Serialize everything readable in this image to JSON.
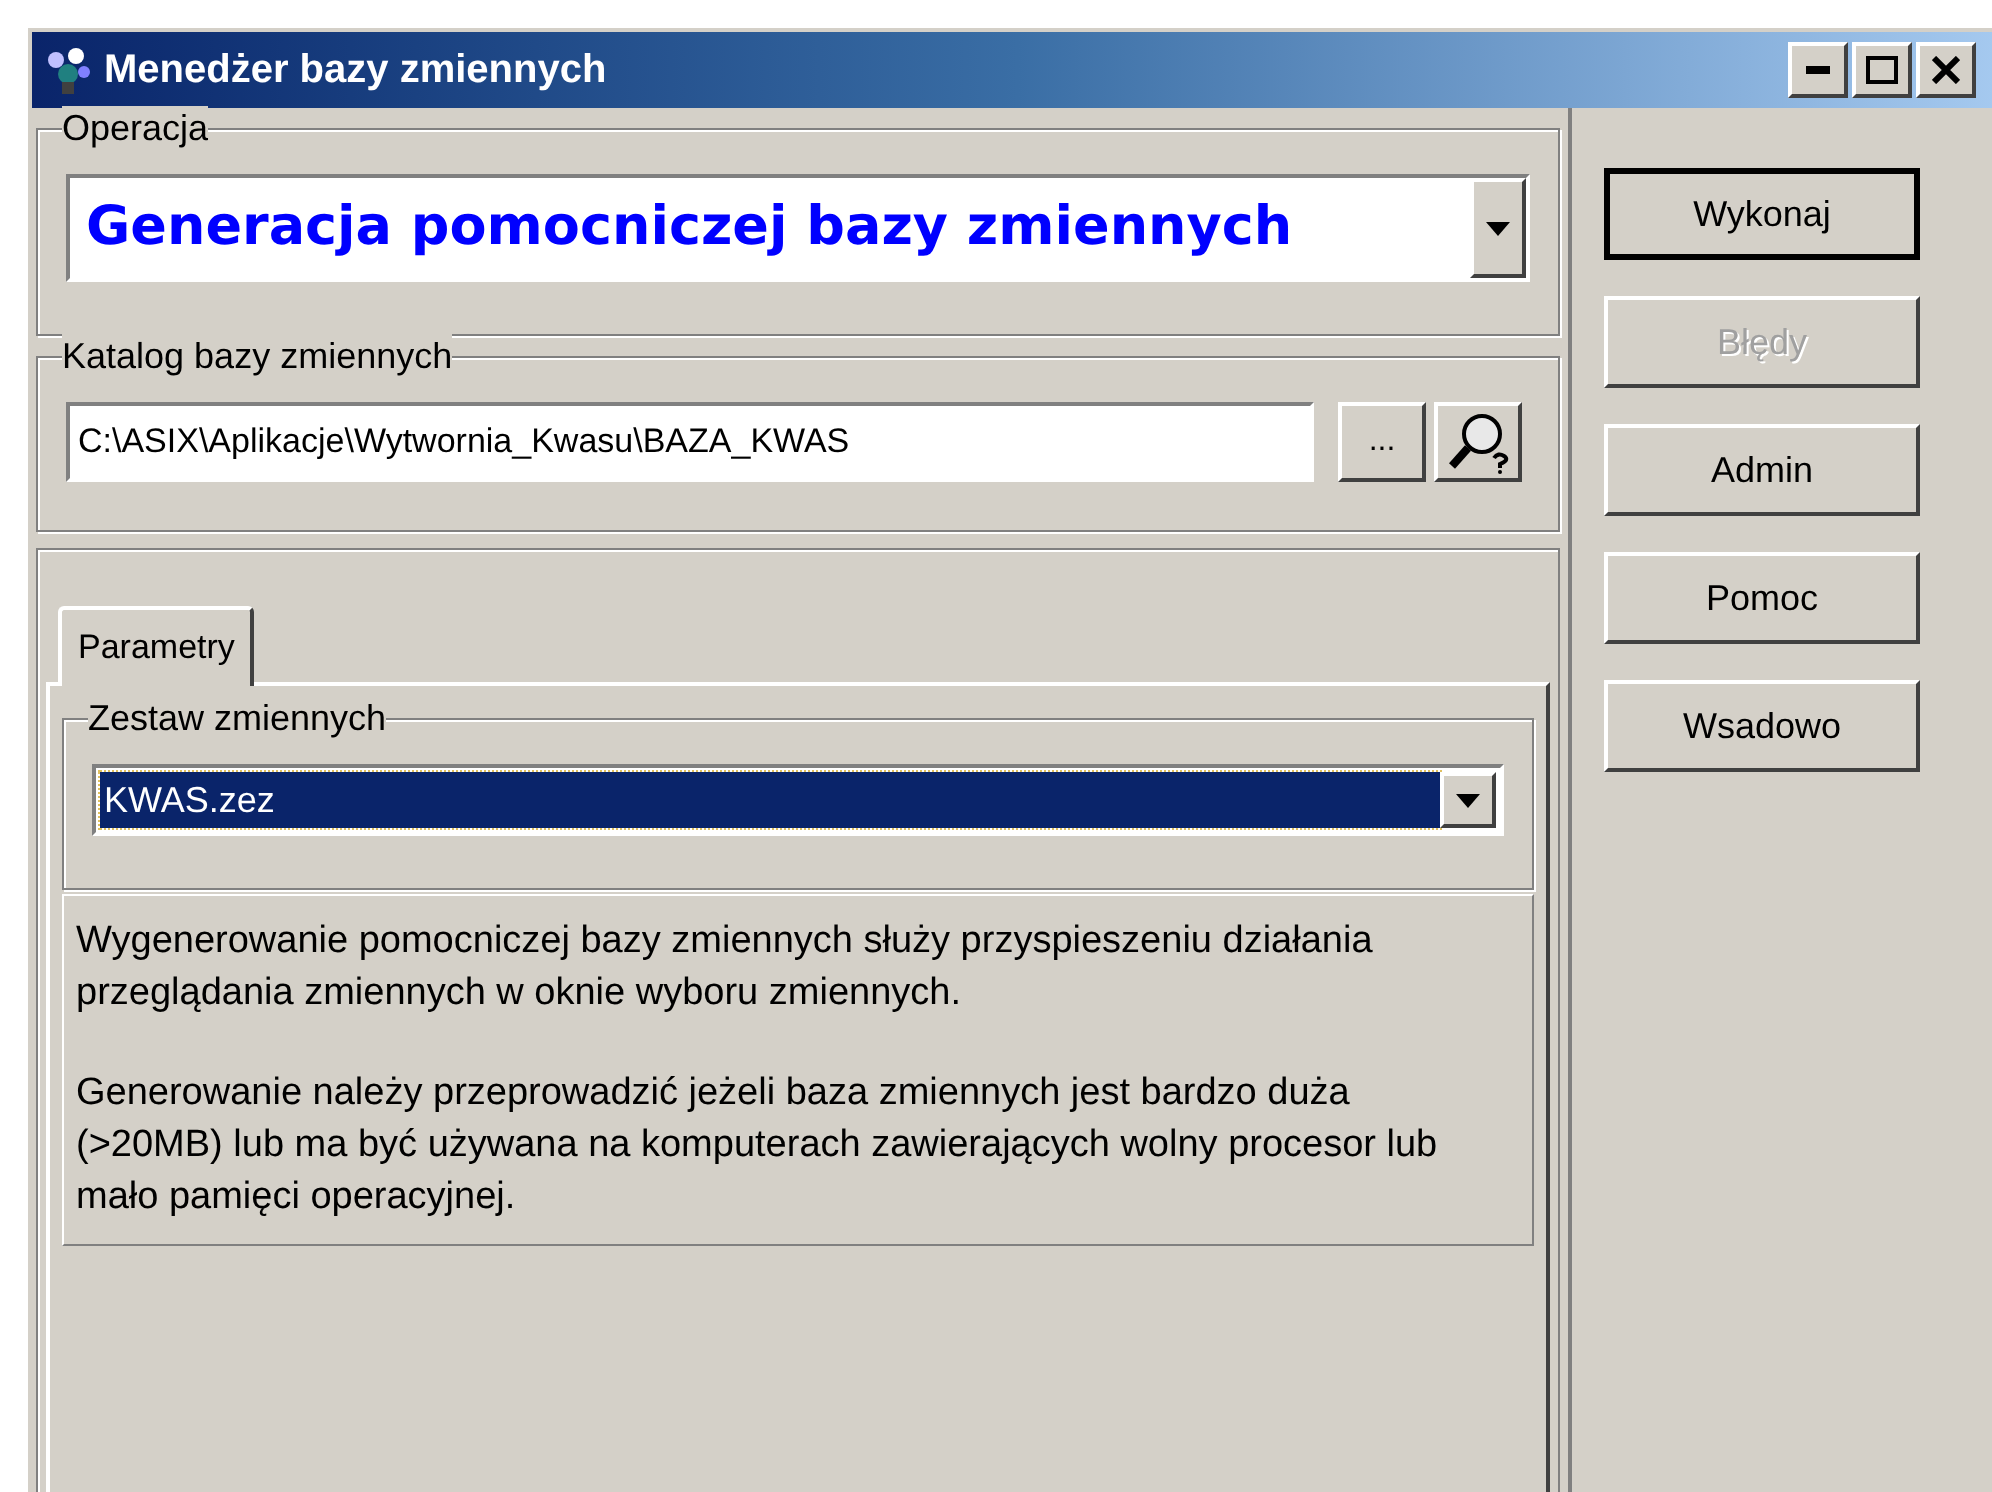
{
  "window": {
    "title": "Menedżer bazy zmiennych"
  },
  "operation": {
    "label": "Operacja",
    "value": "Generacja pomocniczej bazy zmiennych"
  },
  "catalog": {
    "label": "Katalog bazy zmiennych",
    "value": "C:\\ASIX\\Aplikacje\\Wytwornia_Kwasu\\BAZA_KWAS",
    "browse_button": "..."
  },
  "tabs": [
    {
      "label": "Parametry",
      "selected": true
    }
  ],
  "variable_set": {
    "label": "Zestaw zmiennych",
    "value": "KWAS.zez",
    "focused": true
  },
  "description": [
    "Wygenerowanie pomocniczej bazy zmiennych służy przyspieszeniu działania przeglądania zmiennych w oknie wyboru zmiennych.",
    "Generowanie należy przeprowadzić jeżeli baza zmiennych jest bardzo duża (>20MB) lub ma być używana na komputerach zawierających wolny procesor lub mało pamięci operacyjnej."
  ],
  "buttons": [
    {
      "label": "Wykonaj",
      "default": true,
      "disabled": false
    },
    {
      "label": "Błędy",
      "default": false,
      "disabled": true
    },
    {
      "label": "Admin",
      "default": false,
      "disabled": false
    },
    {
      "label": "Pomoc",
      "default": false,
      "disabled": false
    },
    {
      "label": "Wsadowo",
      "default": false,
      "disabled": false
    }
  ]
}
